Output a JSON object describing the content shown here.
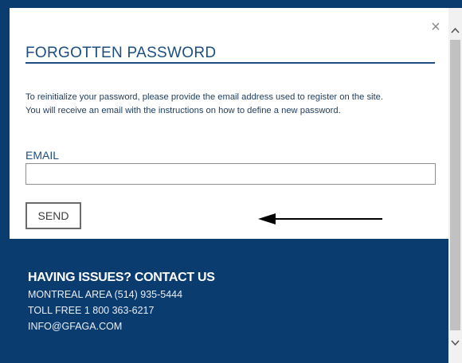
{
  "modal": {
    "title": "FORGOTTEN PASSWORD",
    "close_glyph": "×",
    "info_line1": "To reinitialize your password, please provide the email address used to register on the site.",
    "info_line2": "You will receive an email with the instructions on how to define a new password.",
    "email_label": "EMAIL",
    "email_value": "",
    "send_label": "SEND"
  },
  "footer": {
    "title": "HAVING ISSUES? CONTACT US",
    "line1": "MONTREAL AREA (514) 935-5444",
    "line2": "TOLL FREE 1 800 363-6217",
    "line3": "INFO@GFAGA.COM"
  },
  "scrollbar": {
    "up_icon": "chevron-up-icon",
    "down_icon": "chevron-down-icon"
  },
  "colors": {
    "brand_blue": "#0b3c70",
    "title_blue": "#1c4e82"
  }
}
